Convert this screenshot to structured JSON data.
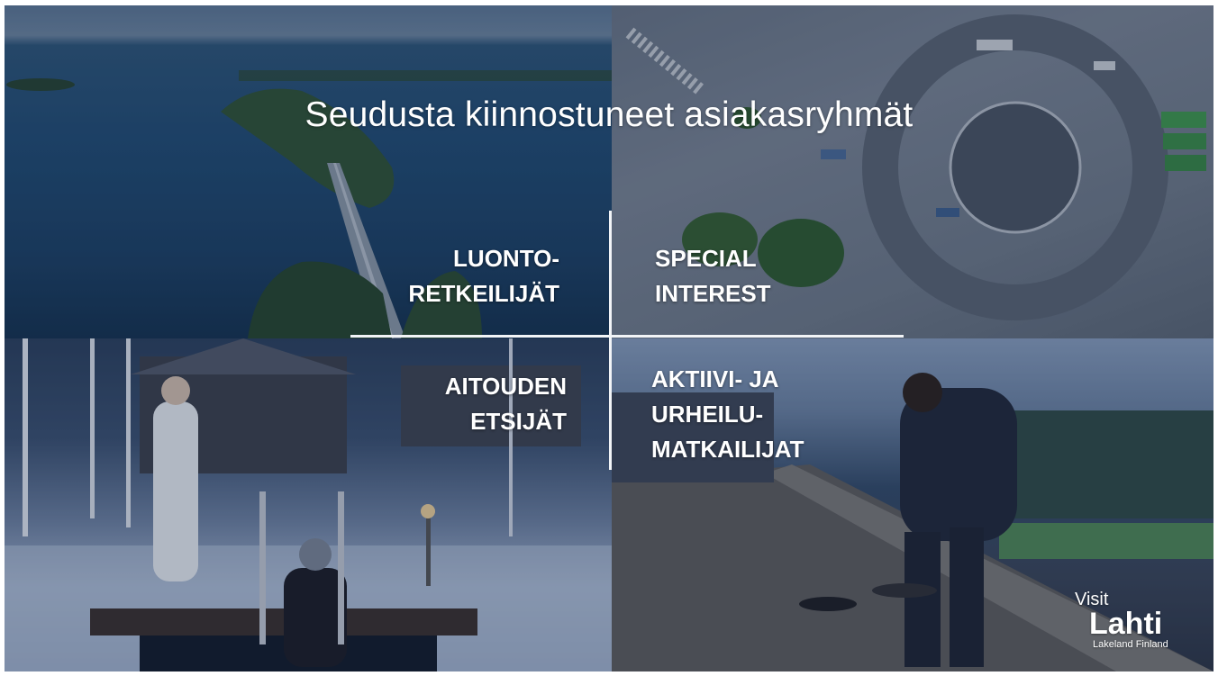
{
  "title": "Seudusta kiinnostuneet asiakasryhmät",
  "quadrants": {
    "top_left": [
      "LUONTO-",
      "RETKEILIJÄT"
    ],
    "top_right": [
      "SPECIAL",
      "INTEREST"
    ],
    "bottom_left": [
      "AITOUDEN",
      "ETSIJÄT"
    ],
    "bottom_right": [
      "AKTIIVI- JA",
      "URHEILU-",
      "MATKAILIJAT"
    ]
  },
  "logo": {
    "visit": "Visit",
    "name": "Lahti",
    "tagline": "Lakeland Finland"
  }
}
